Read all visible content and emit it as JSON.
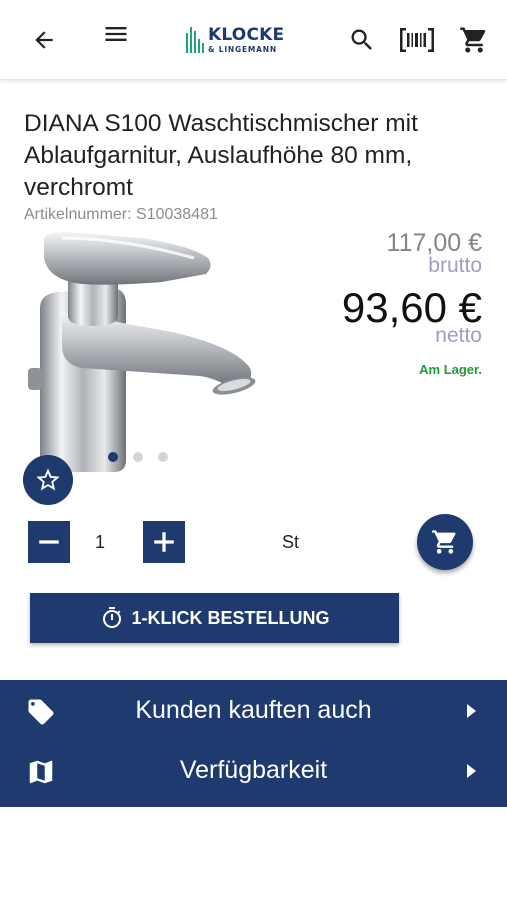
{
  "brand": {
    "name": "KLOCKE",
    "sub": "& LINGEMANN",
    "primary_color": "#1f3a6e",
    "accent_color": "#1fa37f"
  },
  "header": {
    "back_icon": "arrow-back-icon",
    "menu_icon": "menu-icon",
    "search_icon": "search-icon",
    "barcode_icon": "barcode-scan-icon",
    "cart_icon": "cart-icon"
  },
  "product": {
    "title": "DIANA S100 Waschtischmischer mit Ablaufgarnitur, Auslaufhöhe 80 mm, verchromt",
    "sku_label": "Artikelnummer: S10038481",
    "gallery_count": 3,
    "gallery_active": 1,
    "price_gross": "117,00 €",
    "price_gross_label": "brutto",
    "price_net": "93,60 €",
    "price_net_label": "netto",
    "stock": "Am Lager.",
    "stock_color": "#239a3d"
  },
  "order": {
    "quantity": "1",
    "unit": "St",
    "one_click_label": "1-KLICK BESTELLUNG",
    "one_click_icon": "timer-icon",
    "favorite_icon": "star-outline-icon",
    "add_to_cart_icon": "cart-icon"
  },
  "sections": [
    {
      "label": "Kunden kauften auch",
      "icon": "tag-icon"
    },
    {
      "label": "Verfügbarkeit",
      "icon": "map-icon"
    }
  ]
}
